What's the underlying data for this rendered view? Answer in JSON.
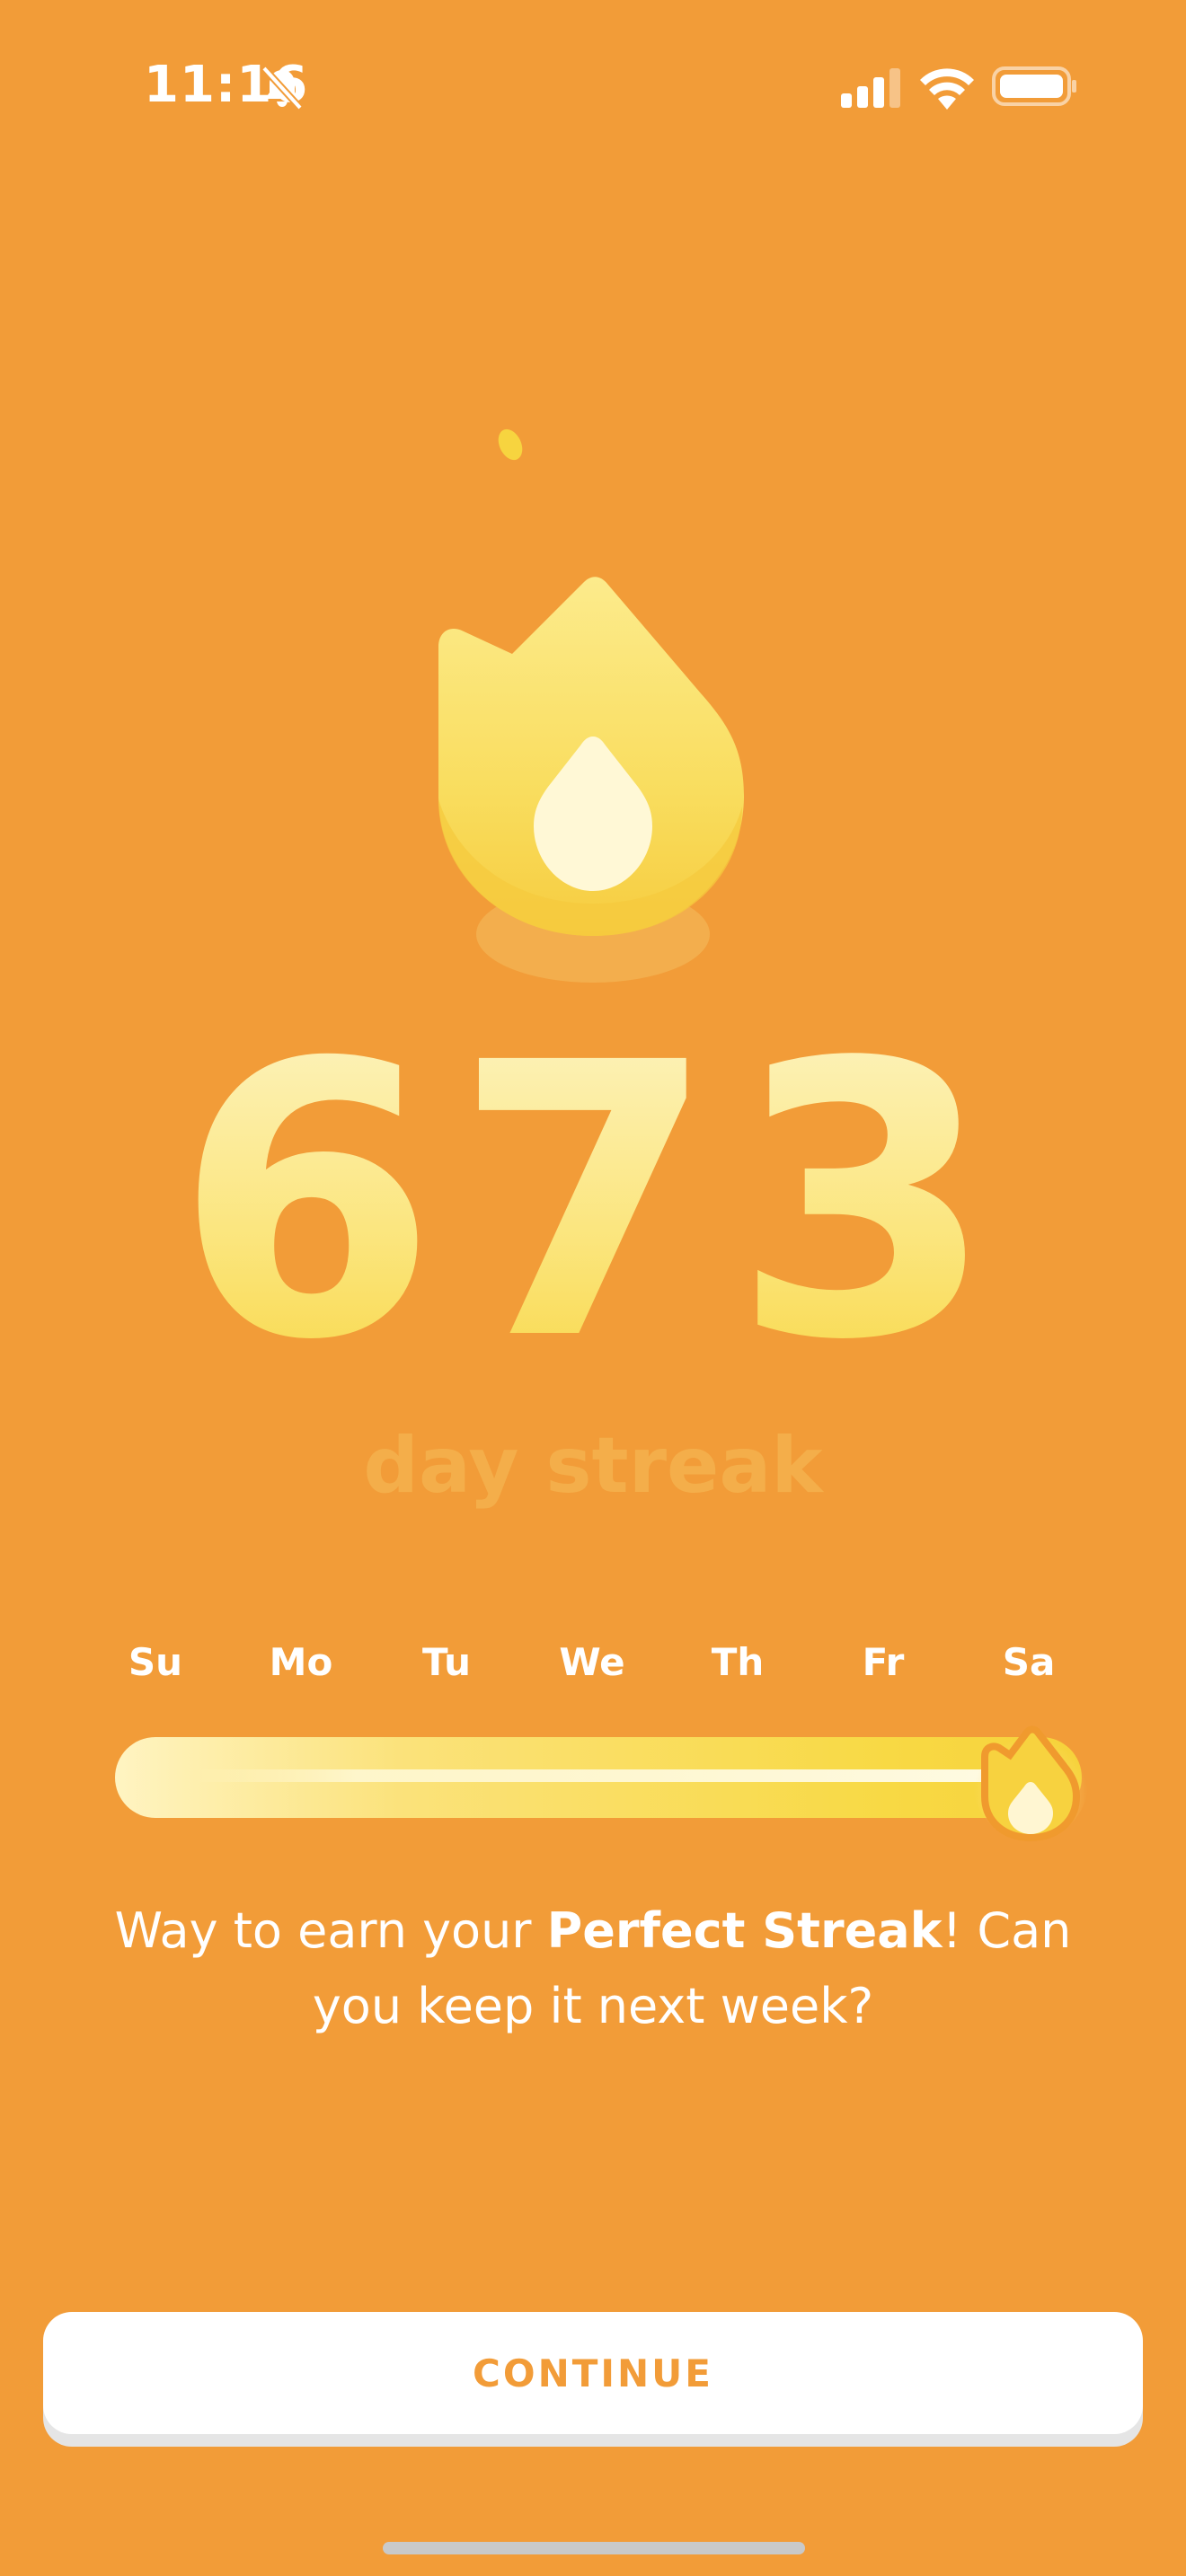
{
  "status_bar": {
    "time": "11:16",
    "icons": [
      "bell-slash-icon",
      "cellular-signal-icon",
      "wifi-icon",
      "battery-icon"
    ]
  },
  "streak": {
    "count": "673",
    "label": "day streak"
  },
  "week": {
    "days": [
      "Su",
      "Mo",
      "Tu",
      "We",
      "Th",
      "Fr",
      "Sa"
    ],
    "completed_days": 7,
    "progress_fraction": 1.0
  },
  "message": {
    "prefix": "Way to earn your ",
    "emphasis": "Perfect Streak",
    "suffix": "! Can you keep it next week?"
  },
  "continue_button": {
    "label": "CONTINUE"
  },
  "colors": {
    "background": "#F29C38",
    "flame_light": "#FBE57C",
    "flame_core": "#FFF8D6",
    "button_text": "#F29C38",
    "label_muted": "#F4AE4A"
  }
}
